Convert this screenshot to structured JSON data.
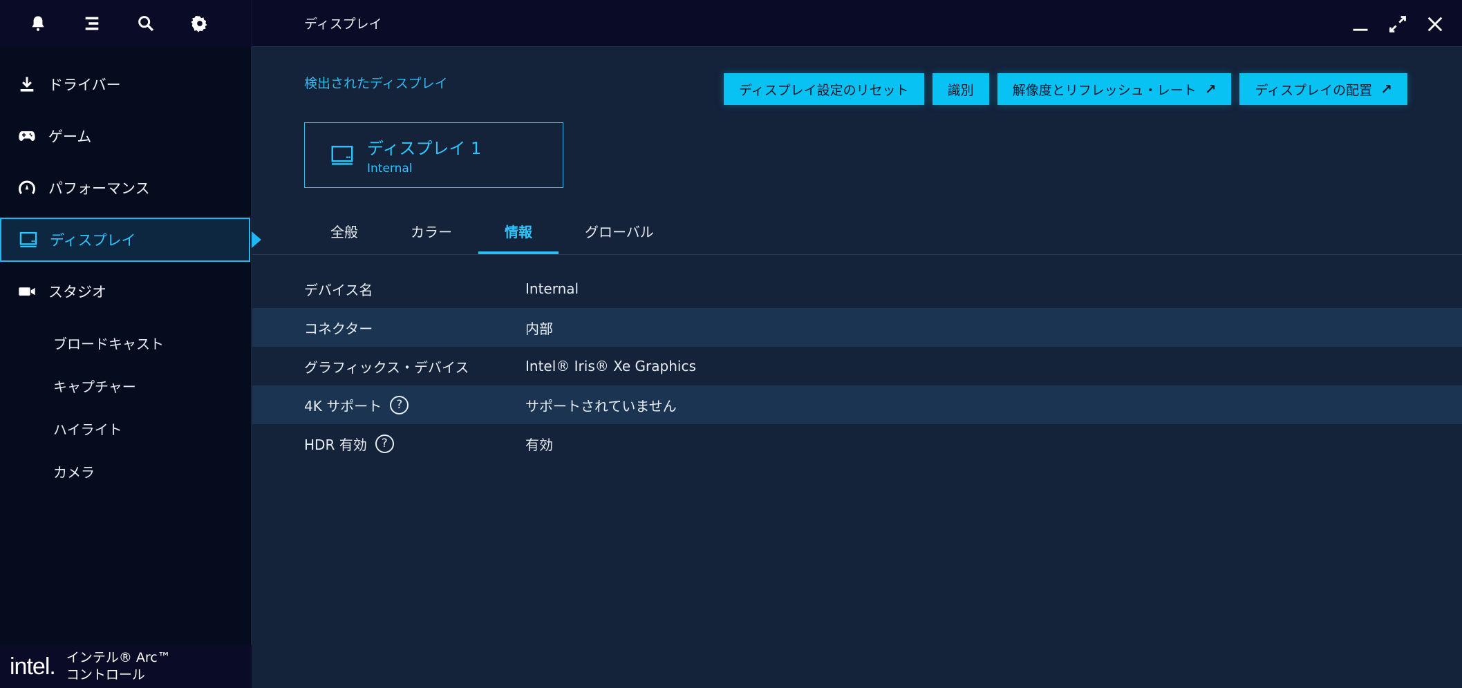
{
  "sidebar": {
    "top_icons": [
      "bell-icon",
      "menu-icon",
      "search-icon",
      "gear-icon"
    ],
    "items": [
      {
        "label": "ドライバー",
        "icon": "download-icon"
      },
      {
        "label": "ゲーム",
        "icon": "gamepad-icon"
      },
      {
        "label": "パフォーマンス",
        "icon": "gauge-icon"
      },
      {
        "label": "ディスプレイ",
        "icon": "monitor-icon",
        "active": true
      },
      {
        "label": "スタジオ",
        "icon": "camera-video-icon"
      }
    ],
    "sub_items": [
      "ブロードキャスト",
      "キャプチャー",
      "ハイライト",
      "カメラ"
    ],
    "brand": {
      "logo": "intel.",
      "line1": "インテル® Arc™",
      "line2": "コントロール"
    }
  },
  "header": {
    "title": "ディスプレイ"
  },
  "main": {
    "detected_label": "検出されたディスプレイ",
    "buttons": {
      "reset": "ディスプレイ設定のリセット",
      "identify": "識別",
      "resolution": "解像度とリフレッシュ・レート",
      "arrangement": "ディスプレイの配置"
    },
    "display_card": {
      "name": "ディスプレイ 1",
      "sub": "Internal"
    },
    "tabs": [
      "全般",
      "カラー",
      "情報",
      "グローバル"
    ],
    "active_tab": "情報",
    "info_rows": [
      {
        "key": "デバイス名",
        "value": "Internal"
      },
      {
        "key": "コネクター",
        "value": "内部"
      },
      {
        "key": "グラフィックス・デバイス",
        "value": "Intel® Iris® Xe Graphics"
      },
      {
        "key": "4K サポート",
        "value": "サポートされていません",
        "help": "?"
      },
      {
        "key": "HDR 有効",
        "value": "有効",
        "help": "?"
      }
    ]
  },
  "colors": {
    "accent": "#08c2f4",
    "background": "#14223a",
    "sidebar": "#050c1e",
    "titlebar": "#0a0b26"
  }
}
